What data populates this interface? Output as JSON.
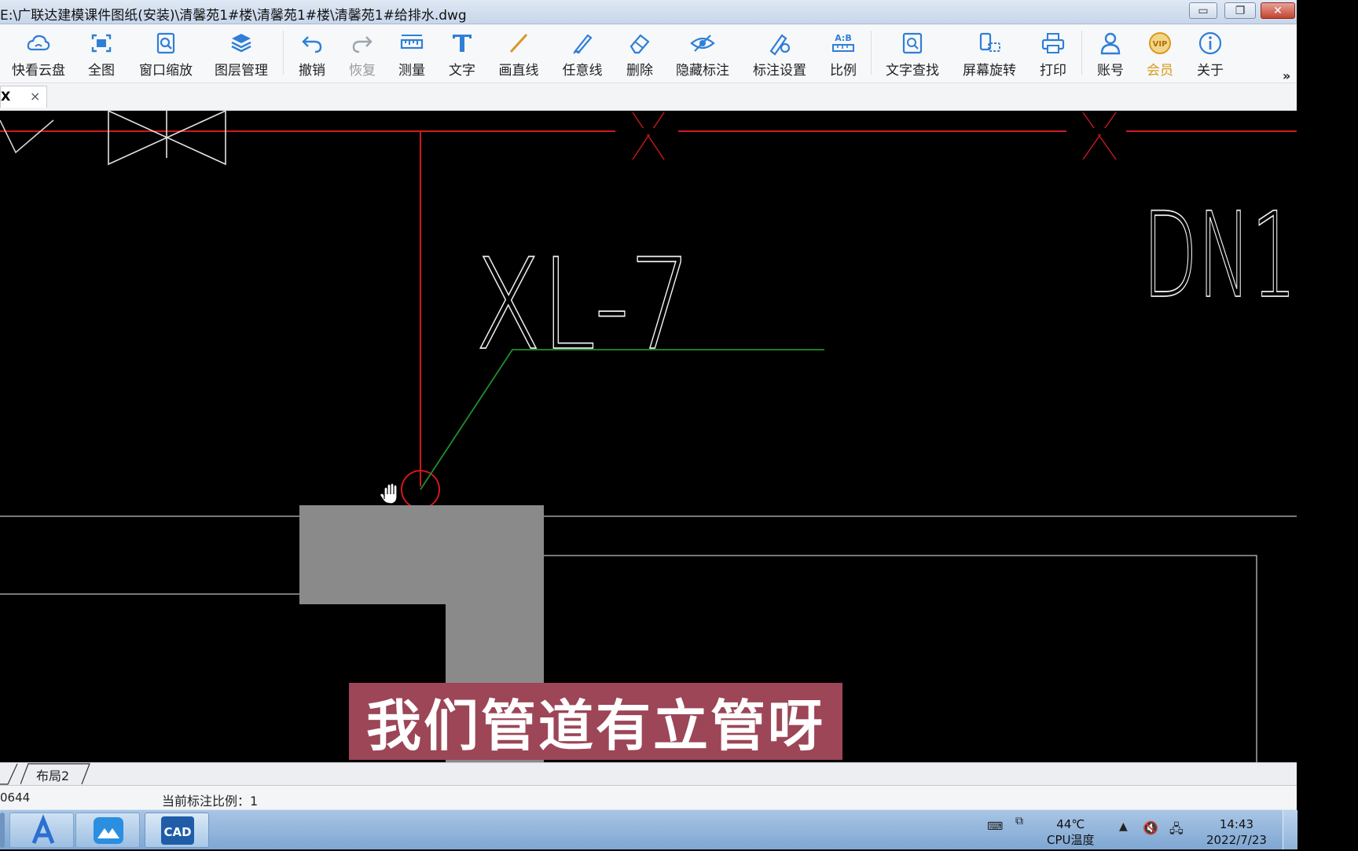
{
  "window": {
    "title": "E:\\广联达建模课件图纸(安装)\\清馨苑1#楼\\清馨苑1#楼\\清馨苑1#给排水.dwg"
  },
  "toolbar": {
    "items": [
      {
        "label": "快看云盘",
        "icon": "cloud-icon"
      },
      {
        "label": "全图",
        "icon": "full-view-icon"
      },
      {
        "label": "窗口缩放",
        "icon": "zoom-window-icon"
      },
      {
        "label": "图层管理",
        "icon": "layers-icon"
      },
      {
        "label": "撤销",
        "icon": "undo-icon"
      },
      {
        "label": "恢复",
        "icon": "redo-icon"
      },
      {
        "label": "测量",
        "icon": "measure-icon"
      },
      {
        "label": "文字",
        "icon": "text-icon"
      },
      {
        "label": "画直线",
        "icon": "line-icon"
      },
      {
        "label": "任意线",
        "icon": "freehand-icon"
      },
      {
        "label": "删除",
        "icon": "eraser-icon"
      },
      {
        "label": "隐藏标注",
        "icon": "hide-annotation-icon"
      },
      {
        "label": "标注设置",
        "icon": "annotation-settings-icon"
      },
      {
        "label": "比例",
        "icon": "scale-icon"
      },
      {
        "label": "文字查找",
        "icon": "text-search-icon"
      },
      {
        "label": "屏幕旋转",
        "icon": "rotate-screen-icon"
      },
      {
        "label": "打印",
        "icon": "print-icon"
      },
      {
        "label": "账号",
        "icon": "account-icon"
      },
      {
        "label": "会员",
        "icon": "vip-icon"
      },
      {
        "label": "关于",
        "icon": "info-icon"
      }
    ],
    "more": "»"
  },
  "doc_tab": {
    "label": "X",
    "close": "×"
  },
  "drawing": {
    "text_xl": "XL-7",
    "text_dn": "DN1",
    "colors": {
      "pipe": "#d0191c",
      "leader": "#1f8f2a",
      "wall": "#8a8a8a",
      "outline": "#bfbfbf"
    }
  },
  "subtitle": "我们管道有立管呀",
  "layout_tabs": [
    "布局2"
  ],
  "status": {
    "coord": "0644",
    "scale": "当前标注比例：1"
  },
  "taskbar": {
    "temperature": "44℃",
    "temp_label": "CPU温度",
    "time": "14:43",
    "date": "2022/7/23"
  }
}
